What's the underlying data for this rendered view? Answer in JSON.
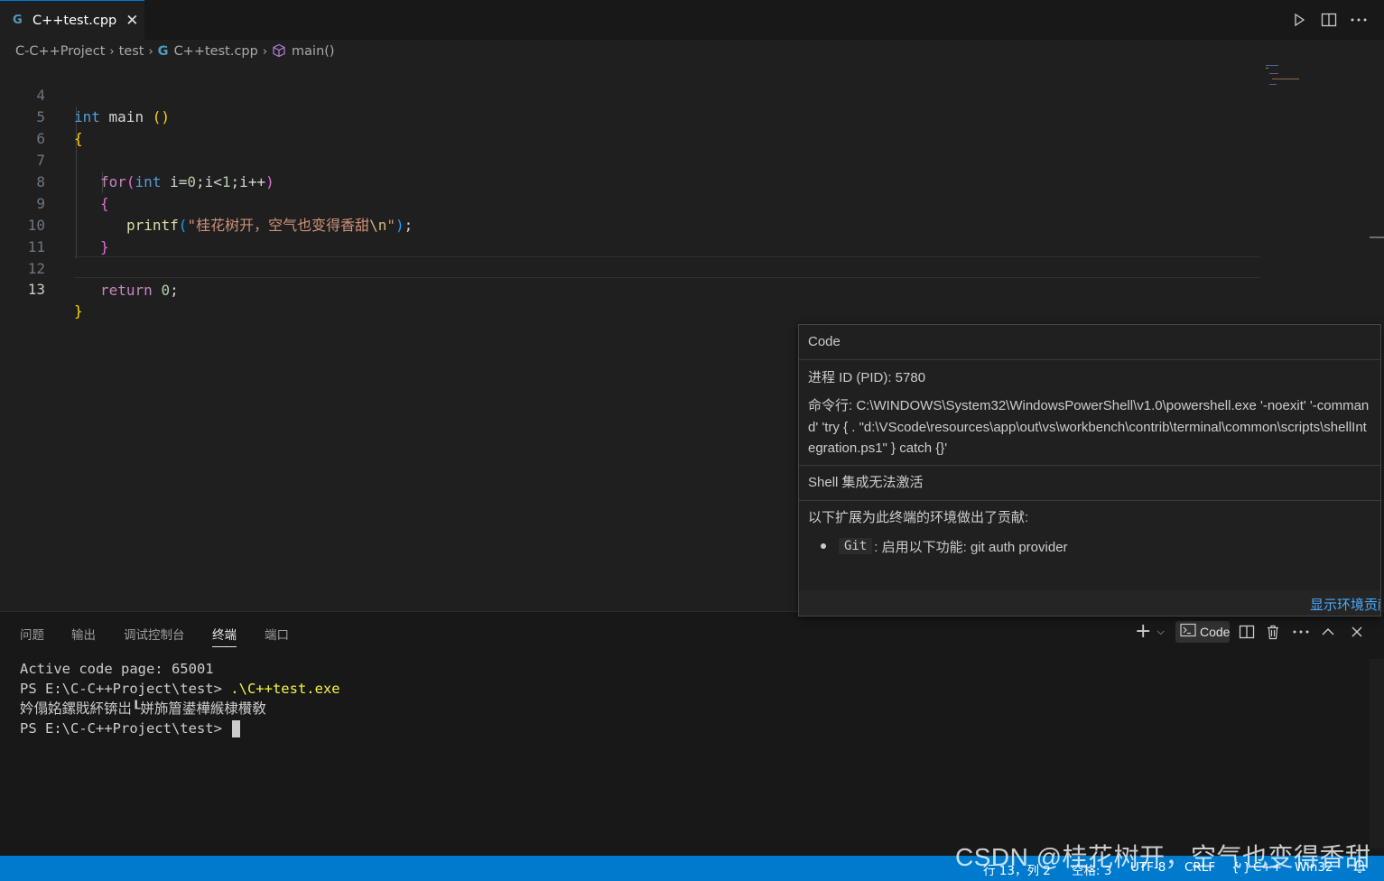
{
  "tab": {
    "icon": "cpp-file-icon",
    "label": "C++test.cpp"
  },
  "breadcrumb": {
    "items": [
      "C-C++Project",
      "test",
      "C++test.cpp",
      "main()"
    ]
  },
  "editor": {
    "line_numbers": [
      "4",
      "5",
      "6",
      "7",
      "8",
      "9",
      "10",
      "11",
      "12",
      "13"
    ],
    "code": {
      "l4_kw": "int",
      "l4_name": " main ",
      "l4_paren": "()",
      "l5": "{",
      "l7_for": "for",
      "l7_open": "(",
      "l7_int": "int",
      "l7_mid1": " i=",
      "l7_n0": "0",
      "l7_mid2": ";i<",
      "l7_n1": "1",
      "l7_mid3": ";i++",
      "l7_close": ")",
      "l8": "{",
      "l9_fn": "printf",
      "l9_open": "(",
      "l9_str": "\"桂花树开，空气也变得香甜",
      "l9_esc": "\\n",
      "l9_strend": "\"",
      "l9_close": ")",
      "l9_semi": ";",
      "l10": "}",
      "l12_ret": "return",
      "l12_sp": " ",
      "l12_num": "0",
      "l12_semi": ";",
      "l13": "}"
    }
  },
  "hover": {
    "title": "Code",
    "pid": "进程 ID (PID): 5780",
    "command_line": "命令行: C:\\WINDOWS\\System32\\WindowsPowerShell\\v1.0\\powershell.exe '-noexit' '-command' 'try { . \"d:\\VScode\\resources\\app\\out\\vs\\workbench\\contrib\\terminal\\common\\scripts\\shellIntegration.ps1\" } catch {}'",
    "shell_status": "Shell 集成无法激活",
    "extensions_heading": "以下扩展为此终端的环境做出了贡献:",
    "extension_code": "Git",
    "extension_desc": ": 启用以下功能: git auth provider",
    "footer_link": "显示环境贡献"
  },
  "panel": {
    "tabs": [
      "问题",
      "输出",
      "调试控制台",
      "终端",
      "端口"
    ],
    "active_tab": "终端",
    "terminal_selector": "Code"
  },
  "terminal": {
    "line1": "Active code page: 65001",
    "line2_prompt": "PS E:\\C-C++Project\\test> ",
    "line2_cmd": ".\\C++test.exe",
    "line3": "妗傝姳鏍戝紑锛岀┖姘斾篃鍙樺緱棣欑敎",
    "line4_prompt": "PS E:\\C-C++Project\\test> "
  },
  "statusbar": {
    "position": "行 13，列 2",
    "spaces": "空格: 3",
    "encoding": "UTF-8",
    "eol": "CRLF",
    "language": "C++",
    "platform": "Win32"
  },
  "watermark": "CSDN @桂花树开，空气也变得香甜",
  "colors": {
    "accent": "#007acc",
    "background": "#1f1f1f"
  }
}
